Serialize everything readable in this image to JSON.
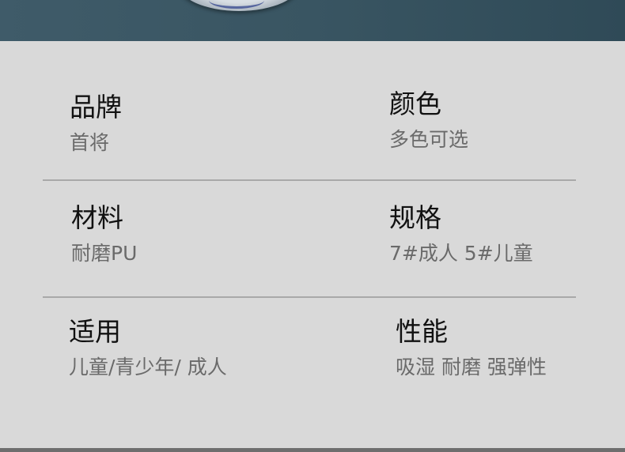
{
  "specs": [
    {
      "label": "品牌",
      "value": "首将"
    },
    {
      "label": "颜色",
      "value": "多色可选"
    },
    {
      "label": "材料",
      "value": "耐磨PU"
    },
    {
      "label": "规格",
      "value": "7#成人 5#儿童"
    },
    {
      "label": "适用",
      "value": "儿童/青少年/ 成人"
    },
    {
      "label": "性能",
      "value": "吸湿 耐磨 强弹性"
    }
  ],
  "colors": {
    "banner": "#395562",
    "background": "#d9d9d9",
    "label": "#111111",
    "value": "#6a6a6a",
    "divider": "#a9a9a9"
  }
}
